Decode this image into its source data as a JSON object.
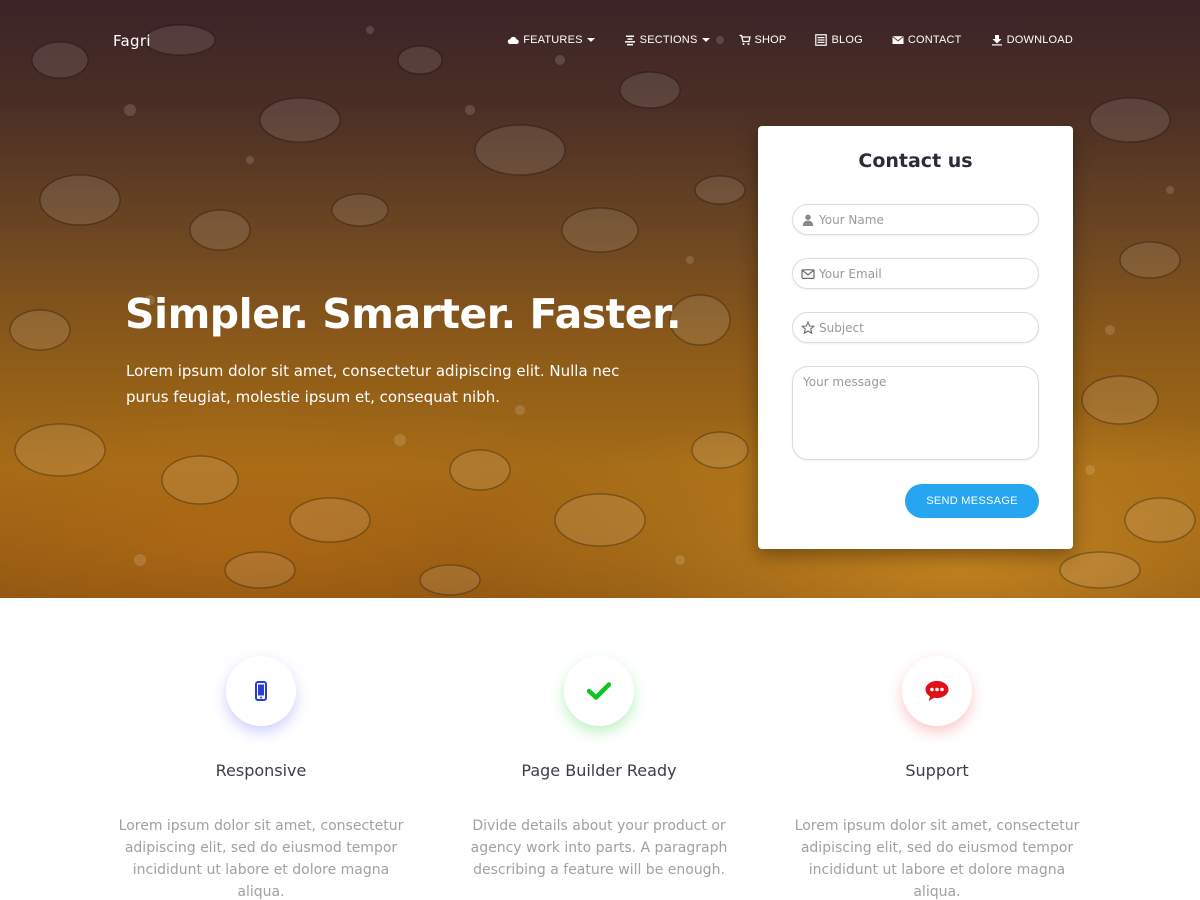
{
  "nav": {
    "brand": "Fagri",
    "items": [
      {
        "label": "FEATURES",
        "icon": "cloud-icon",
        "dropdown": true
      },
      {
        "label": "SECTIONS",
        "icon": "align-center-icon",
        "dropdown": true
      },
      {
        "label": "SHOP",
        "icon": "cart-icon",
        "dropdown": false
      },
      {
        "label": "BLOG",
        "icon": "list-alt-icon",
        "dropdown": false
      },
      {
        "label": "CONTACT",
        "icon": "envelope-icon",
        "dropdown": false
      },
      {
        "label": "DOWNLOAD",
        "icon": "download-icon",
        "dropdown": false
      }
    ]
  },
  "hero": {
    "headline": "Simpler. Smarter. Faster.",
    "subline": "Lorem ipsum dolor sit amet, consectetur adipiscing elit. Nulla nec purus feugiat, molestie ipsum et, consequat nibh."
  },
  "contact": {
    "title": "Contact us",
    "name_placeholder": "Your Name",
    "email_placeholder": "Your Email",
    "subject_placeholder": "Subject",
    "message_placeholder": "Your message",
    "send_label": "SEND MESSAGE",
    "button_color": "#26a5f0"
  },
  "features": [
    {
      "icon": "mobile-icon",
      "icon_color": "#2b3bd6",
      "title": "Responsive",
      "description": "Lorem ipsum dolor sit amet, consectetur adipiscing elit, sed do eiusmod tempor incididunt ut labore et dolore magna aliqua."
    },
    {
      "icon": "check-icon",
      "icon_color": "#12c41f",
      "title": "Page Builder Ready",
      "description": "Divide details about your product or agency work into parts. A paragraph describing a feature will be enough."
    },
    {
      "icon": "chat-icon",
      "icon_color": "#e0101a",
      "title": "Support",
      "description": "Lorem ipsum dolor sit amet, consectetur adipiscing elit, sed do eiusmod tempor incididunt ut labore et dolore magna aliqua."
    }
  ]
}
